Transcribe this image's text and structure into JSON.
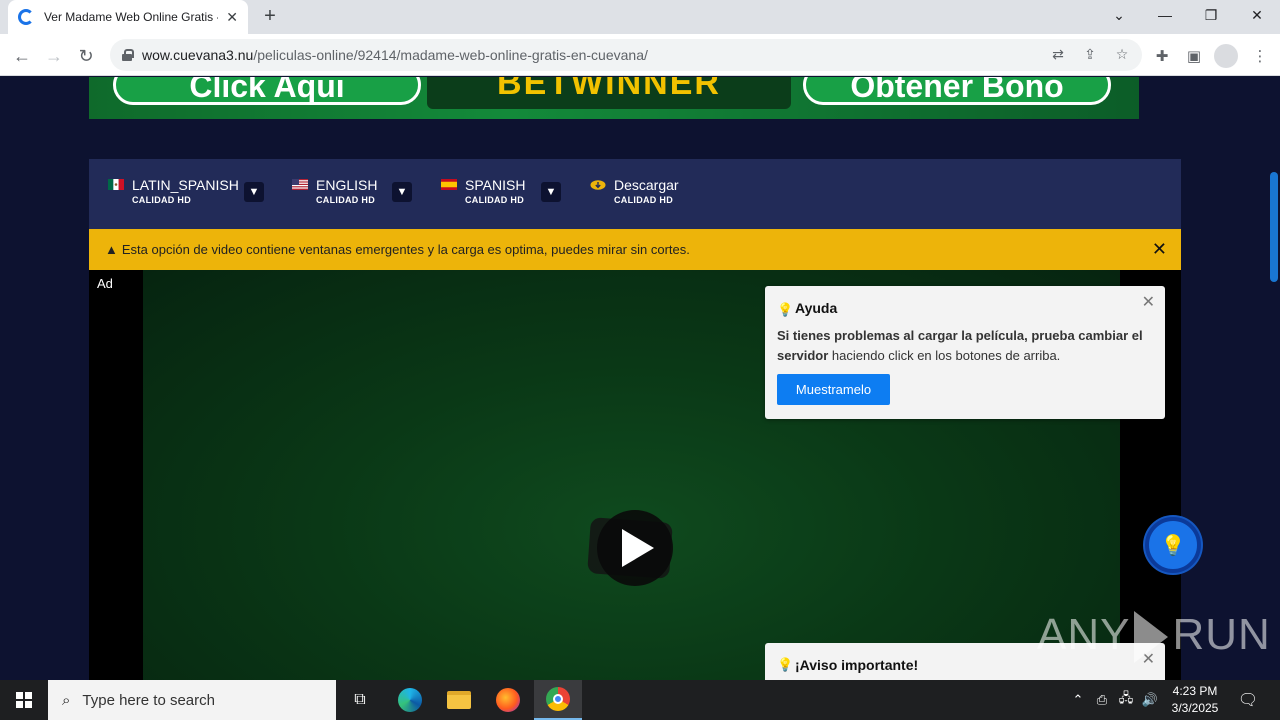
{
  "browser": {
    "tab_title": "Ver Madame Web Online Gratis -",
    "url_host": "wow.cuevana3.nu",
    "url_path": "/peliculas-online/92414/madame-web-online-gratis-en-cuevana/"
  },
  "banner": {
    "left_text": "Click Aqui",
    "center_text": "BETWINNER",
    "right_text": "Obtener Bono"
  },
  "servers": [
    {
      "name": "LATIN_SPANISH",
      "quality": "CALIDAD HD",
      "flag": "mexico-flag"
    },
    {
      "name": "ENGLISH",
      "quality": "CALIDAD HD",
      "flag": "usa-flag"
    },
    {
      "name": "SPANISH",
      "quality": "CALIDAD HD",
      "flag": "spain-flag"
    },
    {
      "name": "Descargar",
      "quality": "CALIDAD HD",
      "flag": "download-cloud-icon"
    }
  ],
  "warning": {
    "text": "Esta opción de video contiene ventanas emergentes y la carga es optima, puedes mirar sin cortes."
  },
  "video": {
    "ad_label": "Ad"
  },
  "help_popup": {
    "title": "Ayuda",
    "text_bold": "Si tienes problemas al cargar la película, prueba cambiar el servidor",
    "text_rest": " haciendo click en los botones de arriba.",
    "button": "Muestramelo"
  },
  "aviso_popup": {
    "title": "¡Aviso importante!"
  },
  "watermark": {
    "left": "ANY",
    "right": "RUN"
  },
  "taskbar": {
    "search_placeholder": "Type here to search",
    "time": "4:23 PM",
    "date": "3/3/2025"
  },
  "colors": {
    "accent": "#1a73e8",
    "warning_bg": "#edb40a",
    "server_bar": "#222b58",
    "page_bg": "#0d1230"
  }
}
